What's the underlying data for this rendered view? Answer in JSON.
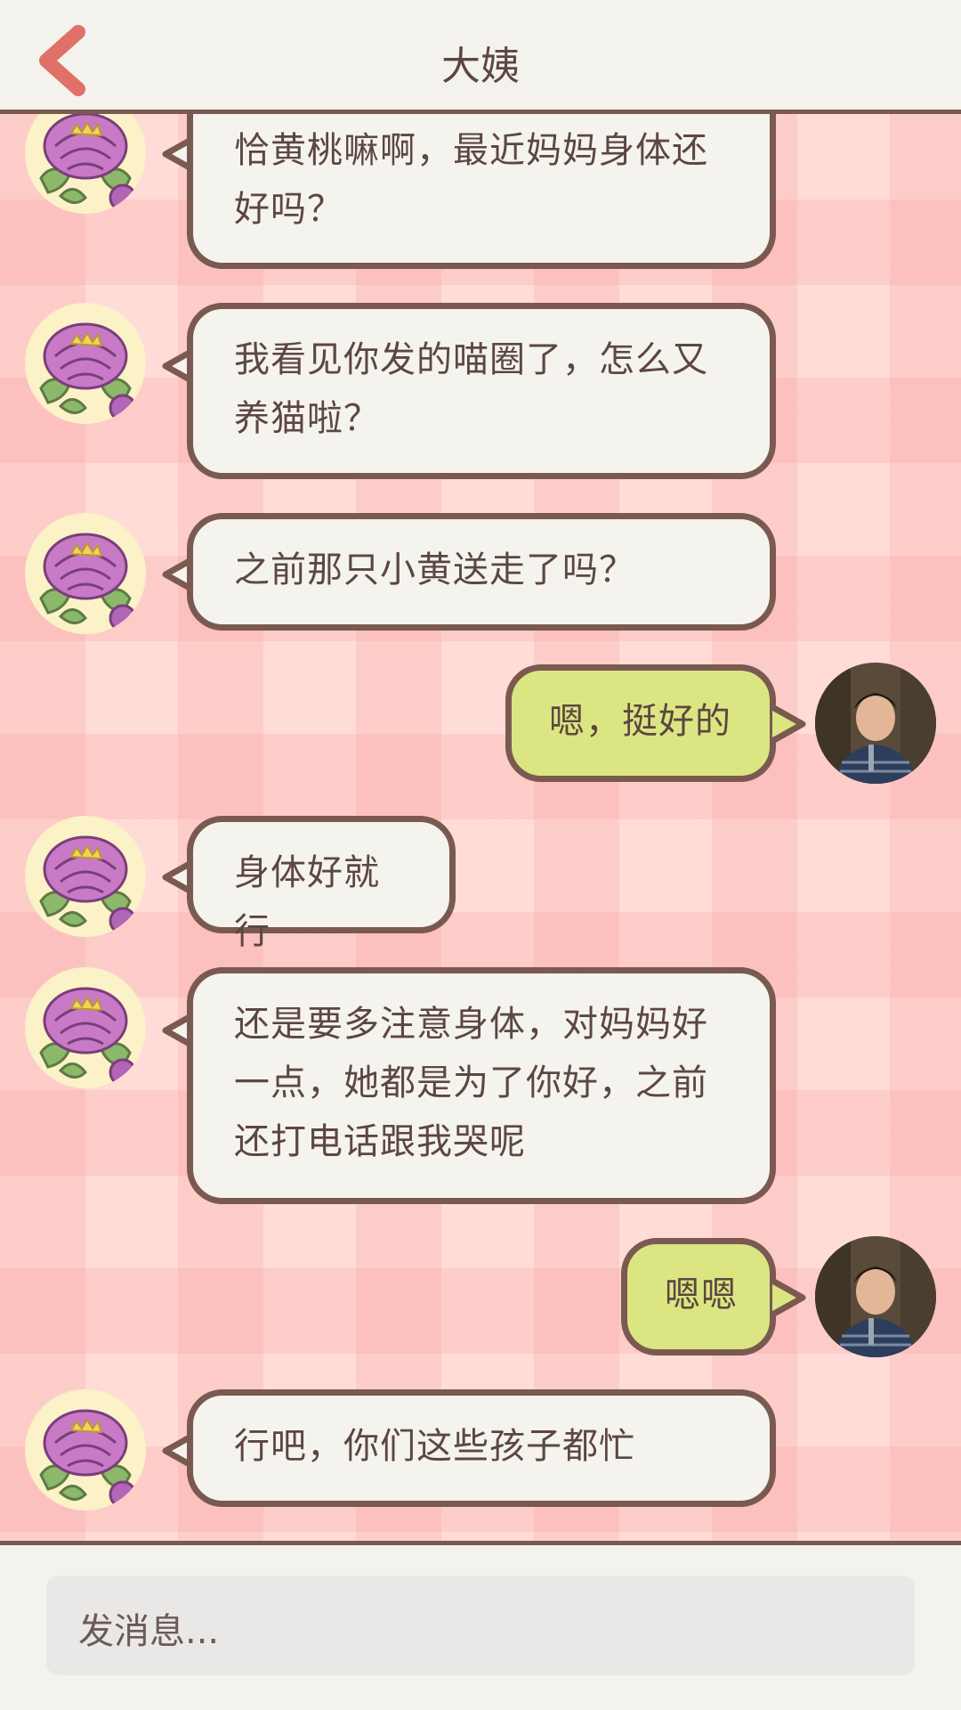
{
  "header": {
    "title": "大姨",
    "back_icon": "chevron-left-icon"
  },
  "colors": {
    "accent_back": "#e07068",
    "border": "#7a5a50",
    "incoming_bubble": "#f5f3ee",
    "outgoing_bubble": "#dbe683",
    "background": "#ffdcd7"
  },
  "messages": [
    {
      "sender": "contact",
      "avatar": "peony-avatar",
      "text": "恰黄桃嘛啊，最近妈妈身体还好吗？"
    },
    {
      "sender": "contact",
      "avatar": "peony-avatar",
      "text": "我看见你发的喵圈了，怎么又养猫啦？"
    },
    {
      "sender": "contact",
      "avatar": "peony-avatar",
      "text": "之前那只小黄送走了吗？"
    },
    {
      "sender": "me",
      "avatar": "user-photo-avatar",
      "text": "嗯，挺好的"
    },
    {
      "sender": "contact",
      "avatar": "peony-avatar",
      "text": "身体好就行"
    },
    {
      "sender": "contact",
      "avatar": "peony-avatar",
      "text": "还是要多注意身体，对妈妈好一点，她都是为了你好，之前还打电话跟我哭呢"
    },
    {
      "sender": "me",
      "avatar": "user-photo-avatar",
      "text": "嗯嗯"
    },
    {
      "sender": "contact",
      "avatar": "peony-avatar",
      "text": "行吧，你们这些孩子都忙"
    }
  ],
  "composer": {
    "placeholder": "发消息..."
  }
}
